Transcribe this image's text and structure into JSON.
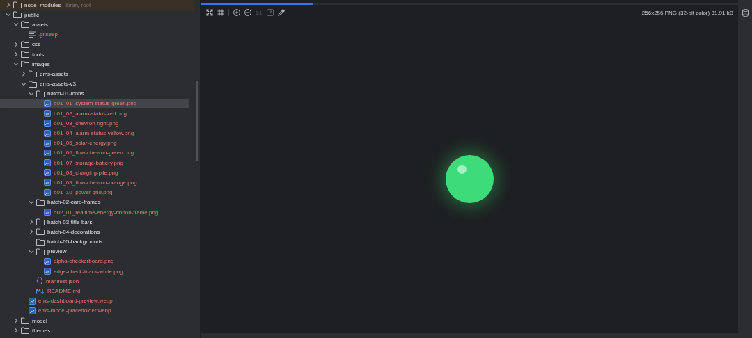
{
  "tree": [
    {
      "name": "node_modules",
      "hint": "library root",
      "kind": "folder",
      "expanded": false,
      "selected": false,
      "excluded": true
    },
    {
      "name": "public",
      "kind": "folder",
      "expanded": true,
      "selected": false,
      "children": [
        {
          "name": "assets",
          "kind": "folder",
          "expanded": true,
          "selected": false,
          "children": [
            {
              "name": ".gitkeep",
              "kind": "text",
              "selected": false
            }
          ]
        },
        {
          "name": "css",
          "kind": "folder",
          "expanded": false,
          "selected": false
        },
        {
          "name": "fonts",
          "kind": "folder",
          "expanded": false,
          "selected": false
        },
        {
          "name": "images",
          "kind": "folder",
          "expanded": true,
          "selected": false,
          "children": [
            {
              "name": "ems-assets",
              "kind": "folder",
              "expanded": false,
              "selected": false
            },
            {
              "name": "ems-assets-v3",
              "kind": "folder",
              "expanded": true,
              "selected": false,
              "children": [
                {
                  "name": "batch-01-icons",
                  "kind": "folder",
                  "expanded": true,
                  "selected": false,
                  "children": [
                    {
                      "name": "b01_01_system-status-green.png",
                      "kind": "image",
                      "selected": true
                    },
                    {
                      "name": "b01_02_alarm-status-red.png",
                      "kind": "image",
                      "selected": false
                    },
                    {
                      "name": "b01_03_chevron-right.png",
                      "kind": "image",
                      "selected": false
                    },
                    {
                      "name": "b01_04_alarm-status-yellow.png",
                      "kind": "image",
                      "selected": false
                    },
                    {
                      "name": "b01_05_solar-energy.png",
                      "kind": "image",
                      "selected": false
                    },
                    {
                      "name": "b01_06_flow-chevron-green.png",
                      "kind": "image",
                      "selected": false
                    },
                    {
                      "name": "b01_07_storage-battery.png",
                      "kind": "image",
                      "selected": false
                    },
                    {
                      "name": "b01_08_charging-pile.png",
                      "kind": "image",
                      "selected": false
                    },
                    {
                      "name": "b01_09_flow-chevron-orange.png",
                      "kind": "image",
                      "selected": false
                    },
                    {
                      "name": "b01_10_power-grid.png",
                      "kind": "image",
                      "selected": false
                    }
                  ]
                },
                {
                  "name": "batch-02-card-frames",
                  "kind": "folder",
                  "expanded": true,
                  "selected": false,
                  "children": [
                    {
                      "name": "b02_01_realtime-energy-ribbon-frame.png",
                      "kind": "image",
                      "selected": false
                    }
                  ]
                },
                {
                  "name": "batch-03-title-bars",
                  "kind": "folder",
                  "expanded": false,
                  "selected": false
                },
                {
                  "name": "batch-04-decorations",
                  "kind": "folder",
                  "expanded": false,
                  "selected": false
                },
                {
                  "name": "batch-05-backgrounds",
                  "kind": "folder",
                  "selected": false
                },
                {
                  "name": "preview",
                  "kind": "folder",
                  "expanded": true,
                  "selected": false,
                  "children": [
                    {
                      "name": "alpha-checkerboard.png",
                      "kind": "image",
                      "selected": false
                    },
                    {
                      "name": "edge-check-black-white.png",
                      "kind": "image",
                      "selected": false
                    }
                  ]
                },
                {
                  "name": "manifest.json",
                  "kind": "json",
                  "selected": false
                },
                {
                  "name": "README.md",
                  "kind": "markdown",
                  "selected": false
                }
              ]
            },
            {
              "name": "ems-dashboard-preview.webp",
              "kind": "image",
              "selected": false
            },
            {
              "name": "ems-model-placeholder.webp",
              "kind": "image",
              "selected": false
            }
          ]
        },
        {
          "name": "model",
          "kind": "folder",
          "expanded": false,
          "selected": false
        },
        {
          "name": "themes",
          "kind": "folder",
          "expanded": false,
          "selected": false
        }
      ]
    }
  ],
  "viewer": {
    "loading": {
      "level": 0.21
    },
    "toolbar": [
      {
        "kind": "expand",
        "disabled": false
      },
      {
        "kind": "grid",
        "disabled": false
      },
      {
        "kind": "zoom-in",
        "disabled": false
      },
      {
        "kind": "zoom-out",
        "disabled": false
      },
      {
        "kind": "text",
        "label": "1:1",
        "disabled": true
      },
      {
        "kind": "fit",
        "disabled": true
      },
      {
        "kind": "picker",
        "disabled": false
      }
    ],
    "info": "256x256 PNG (32-bit color) 31.91 kB"
  }
}
